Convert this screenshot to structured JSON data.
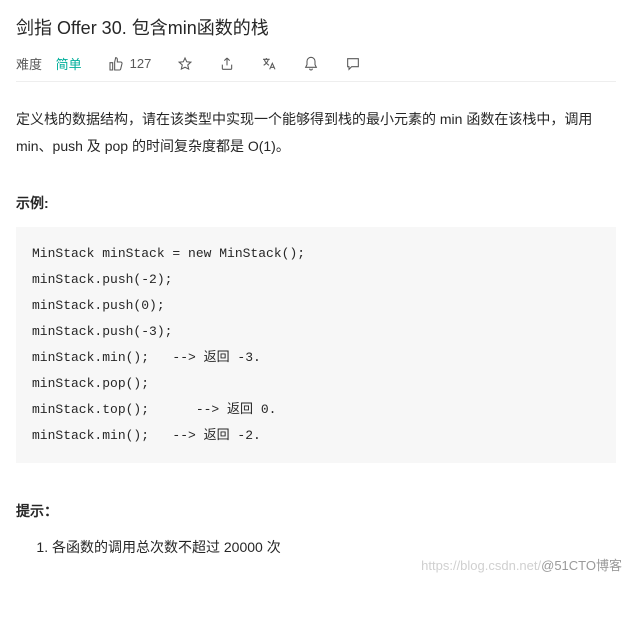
{
  "title": "剑指 Offer 30. 包含min函数的栈",
  "meta": {
    "difficulty_label": "难度",
    "difficulty_value": "简单",
    "likes": "127"
  },
  "description": "定义栈的数据结构，请在该类型中实现一个能够得到栈的最小元素的 min 函数在该栈中，调用 min、push 及 pop 的时间复杂度都是 O(1)。",
  "example": {
    "heading": "示例:",
    "code": "MinStack minStack = new MinStack();\nminStack.push(-2);\nminStack.push(0);\nminStack.push(-3);\nminStack.min();   --> 返回 -3.\nminStack.pop();\nminStack.top();      --> 返回 0.\nminStack.min();   --> 返回 -2."
  },
  "tips": {
    "heading": "提示：",
    "items": [
      "各函数的调用总次数不超过 20000 次"
    ]
  },
  "watermark": {
    "faint": "https://blog.csdn.net/",
    "handle": "@51CTO博客"
  }
}
